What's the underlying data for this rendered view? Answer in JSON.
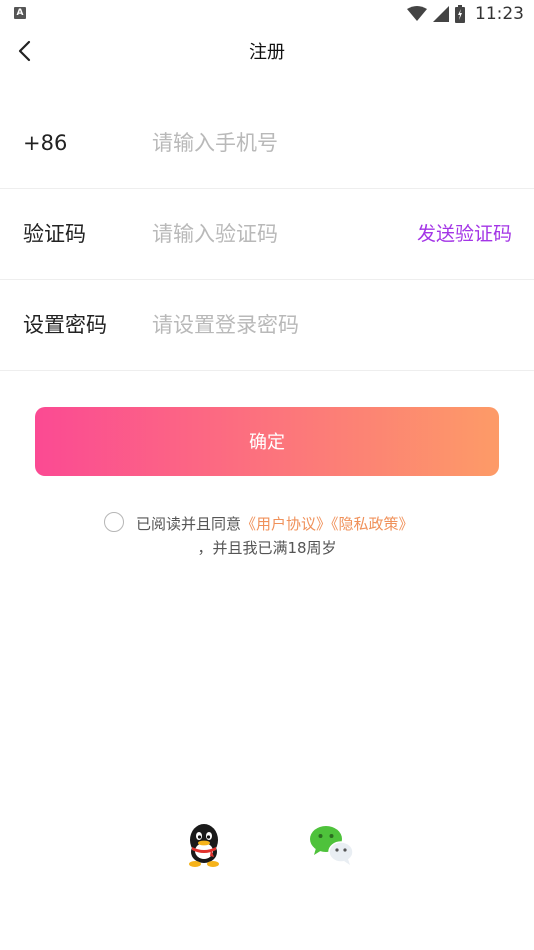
{
  "status_bar": {
    "badge": "A",
    "time": "11:23"
  },
  "nav": {
    "title": "注册"
  },
  "form": {
    "phone": {
      "prefix": "+86",
      "placeholder": "请输入手机号",
      "value": ""
    },
    "code": {
      "label": "验证码",
      "placeholder": "请输入验证码",
      "value": "",
      "send_label": "发送验证码"
    },
    "password": {
      "label": "设置密码",
      "placeholder": "请设置登录密码",
      "value": ""
    }
  },
  "confirm_label": "确定",
  "agreement": {
    "prefix": "已阅读并且同意",
    "user_agreement": "《用户协议》",
    "privacy_policy": "《隐私政策》",
    "line2": "，并且我已满18周岁"
  },
  "social_login": [
    "qq-icon",
    "wechat-icon"
  ],
  "colors": {
    "accent_purple": "#a335e6",
    "link_orange": "#f0915a",
    "button_gradient_start": "#fb4a93",
    "button_gradient_end": "#fd9b67"
  }
}
